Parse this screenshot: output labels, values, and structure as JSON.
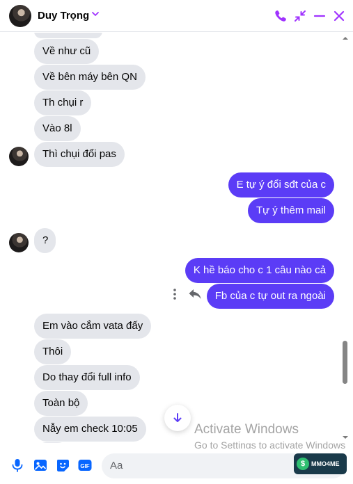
{
  "header": {
    "contact_name": "Duy Trọng",
    "icons": [
      "phone-icon",
      "minimize-arrows-icon",
      "minus-icon",
      "close-icon"
    ],
    "accent": "#a033ff"
  },
  "messages": [
    {
      "side": "in",
      "text": "Về như cũ"
    },
    {
      "side": "in",
      "text": "Về bên máy bên QN"
    },
    {
      "side": "in",
      "text": "Th chụi r"
    },
    {
      "side": "in",
      "text": "Vào 8l"
    },
    {
      "side": "in",
      "text": "Thì chụi đổi pas"
    },
    {
      "side": "out",
      "text": "E tự ý đổi sđt của c"
    },
    {
      "side": "out",
      "text": "Tự ý thêm mail"
    },
    {
      "side": "in",
      "text": "?"
    },
    {
      "side": "out",
      "text": "K hề báo cho c 1 câu nào cả"
    },
    {
      "side": "out",
      "text": "Fb của c tự out ra ngoài"
    },
    {
      "side": "in",
      "text": "Em vào cắm vata đấy"
    },
    {
      "side": "in",
      "text": "Thôi"
    },
    {
      "side": "in",
      "text": "Do thay đổi full info"
    },
    {
      "side": "in",
      "text": "Toàn bộ"
    },
    {
      "side": "in",
      "text": "Nẫy em check 10:05"
    }
  ],
  "watermark": {
    "title": "Activate Windows",
    "subtitle": "Go to Settings to activate Windows"
  },
  "composer": {
    "placeholder": "Aa",
    "icons": [
      "microphone-icon",
      "image-icon",
      "sticker-icon",
      "gif-icon"
    ]
  },
  "badge": {
    "text": "MMO4ME"
  },
  "colors": {
    "outgoing": "#5b3cf6",
    "incoming": "#e4e6eb",
    "icon_accent": "#a033ff",
    "footer_icon": "#0866ff"
  }
}
